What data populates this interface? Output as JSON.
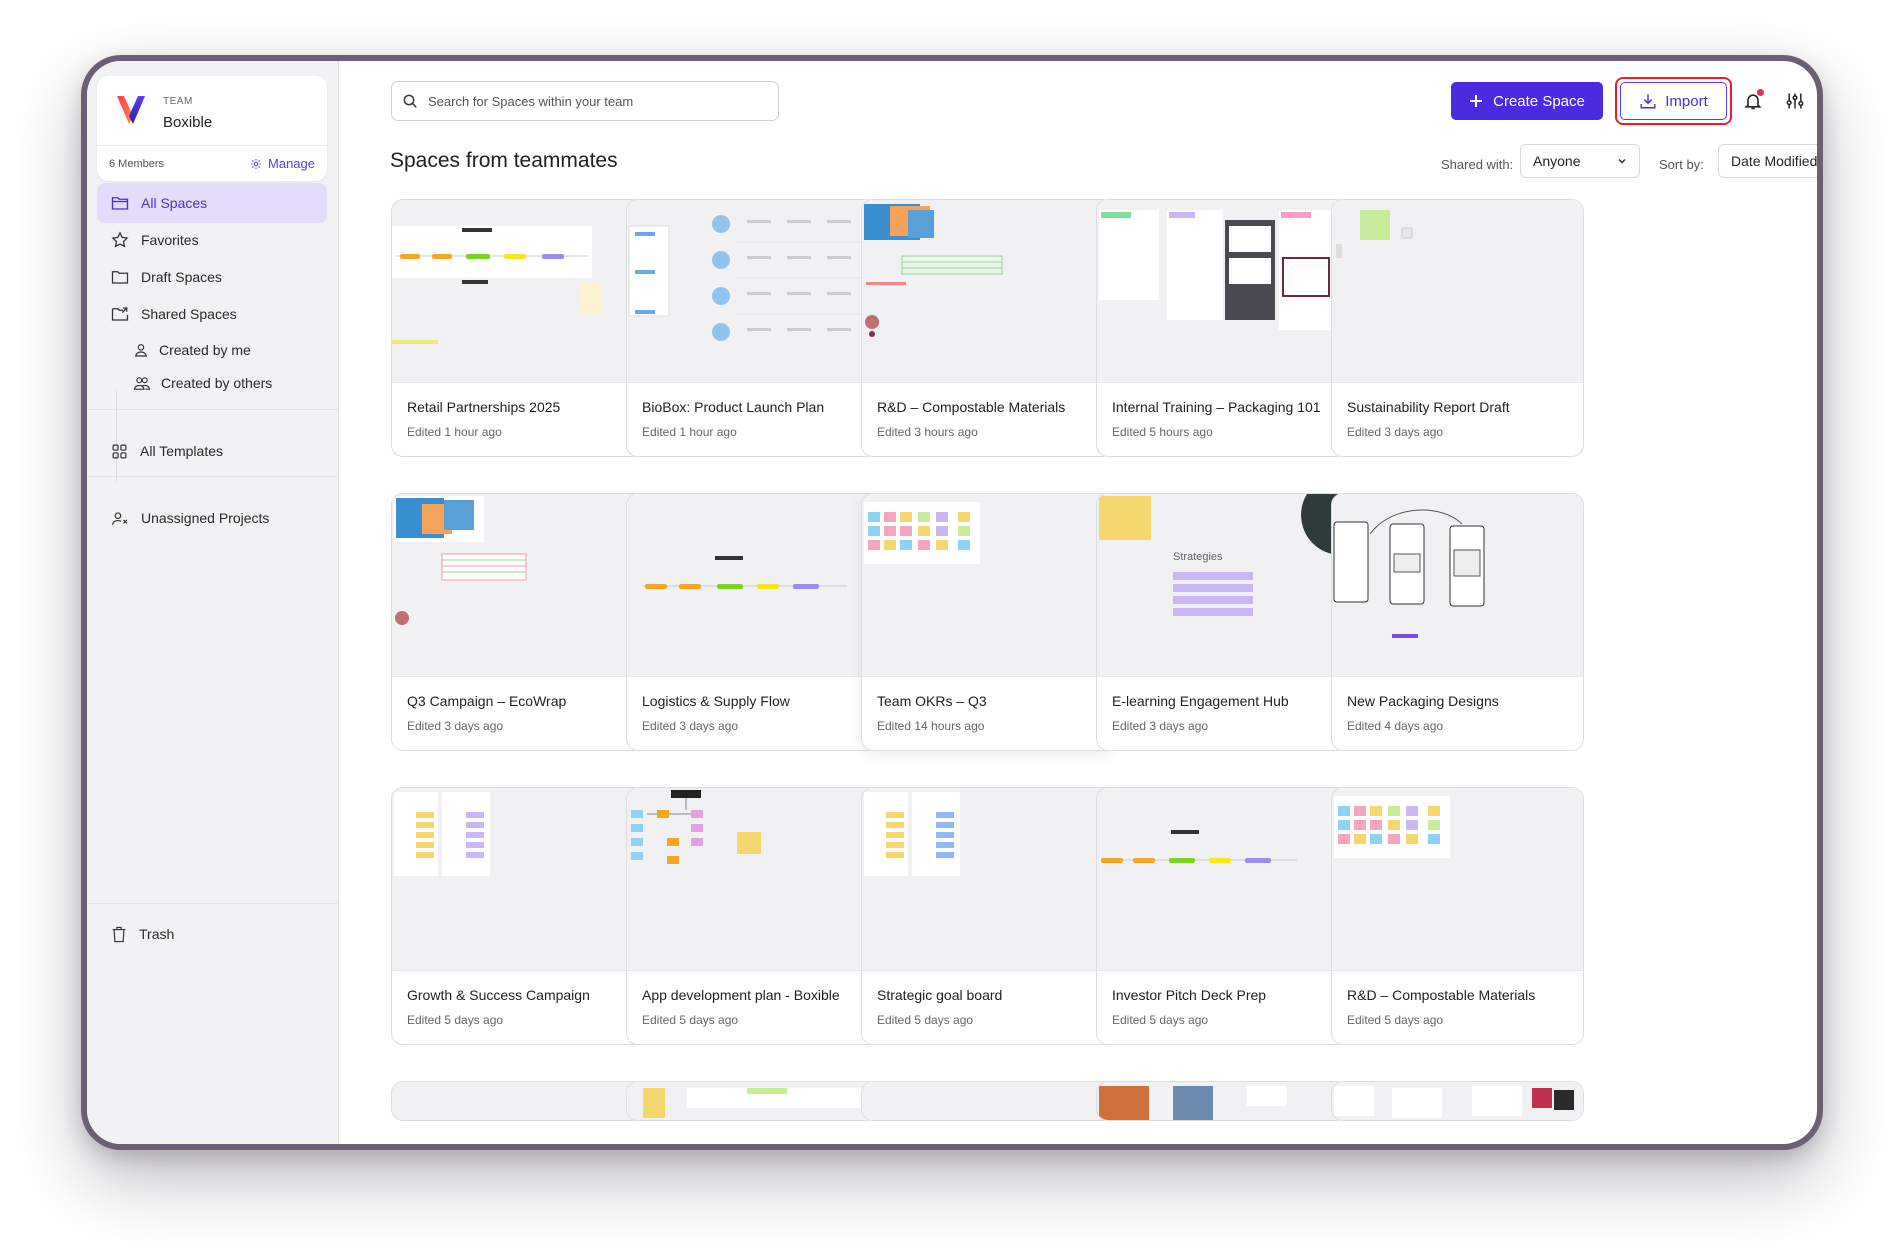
{
  "team": {
    "label": "TEAM",
    "name": "Boxible",
    "members": "6 Members",
    "manage": "Manage"
  },
  "nav": {
    "all_spaces": "All Spaces",
    "favorites": "Favorites",
    "draft_spaces": "Draft Spaces",
    "shared_spaces": "Shared Spaces",
    "created_by_me": "Created by me",
    "created_by_others": "Created by others",
    "all_templates": "All Templates",
    "unassigned_projects": "Unassigned Projects",
    "trash": "Trash"
  },
  "search": {
    "placeholder": "Search for Spaces within your team"
  },
  "toolbar": {
    "create_label": "Create Space",
    "import_label": "Import"
  },
  "section": {
    "title": "Spaces from teammates",
    "shared_label": "Shared with:",
    "shared_value": "Anyone",
    "sort_label": "Sort by:",
    "sort_value": "Date Modified"
  },
  "colors": {
    "accent": "#4b2be0",
    "accent_light": "#e4dcfb",
    "highlight": "#e5202c"
  },
  "cards": [
    {
      "title": "Retail Partnerships 2025",
      "edited": "Edited 1 hour ago"
    },
    {
      "title": "BioBox: Product Launch Plan",
      "edited": "Edited 1 hour ago"
    },
    {
      "title": "R&D – Compostable Materials",
      "edited": "Edited 3 hours ago"
    },
    {
      "title": "Internal Training – Packaging 101",
      "edited": "Edited 5 hours ago"
    },
    {
      "title": "Sustainability Report Draft",
      "edited": "Edited 3 days ago"
    },
    {
      "title": "Q3 Campaign – EcoWrap",
      "edited": "Edited 3 days ago"
    },
    {
      "title": "Logistics & Supply Flow",
      "edited": "Edited 3 days ago"
    },
    {
      "title": "Team OKRs – Q3",
      "edited": "Edited 14 hours ago"
    },
    {
      "title": "E-learning Engagement Hub",
      "edited": "Edited 3 days ago"
    },
    {
      "title": "New Packaging Designs",
      "edited": "Edited 4 days ago"
    },
    {
      "title": "Growth & Success Campaign",
      "edited": "Edited 5 days ago"
    },
    {
      "title": "App development plan - Boxible",
      "edited": "Edited 5 days ago"
    },
    {
      "title": "Strategic goal board",
      "edited": "Edited 5 days ago"
    },
    {
      "title": "Investor Pitch Deck Prep",
      "edited": "Edited 5 days ago"
    },
    {
      "title": "R&D – Compostable Materials",
      "edited": "Edited 5 days ago"
    }
  ],
  "thumb_text": {
    "strategies": "Strategies"
  }
}
